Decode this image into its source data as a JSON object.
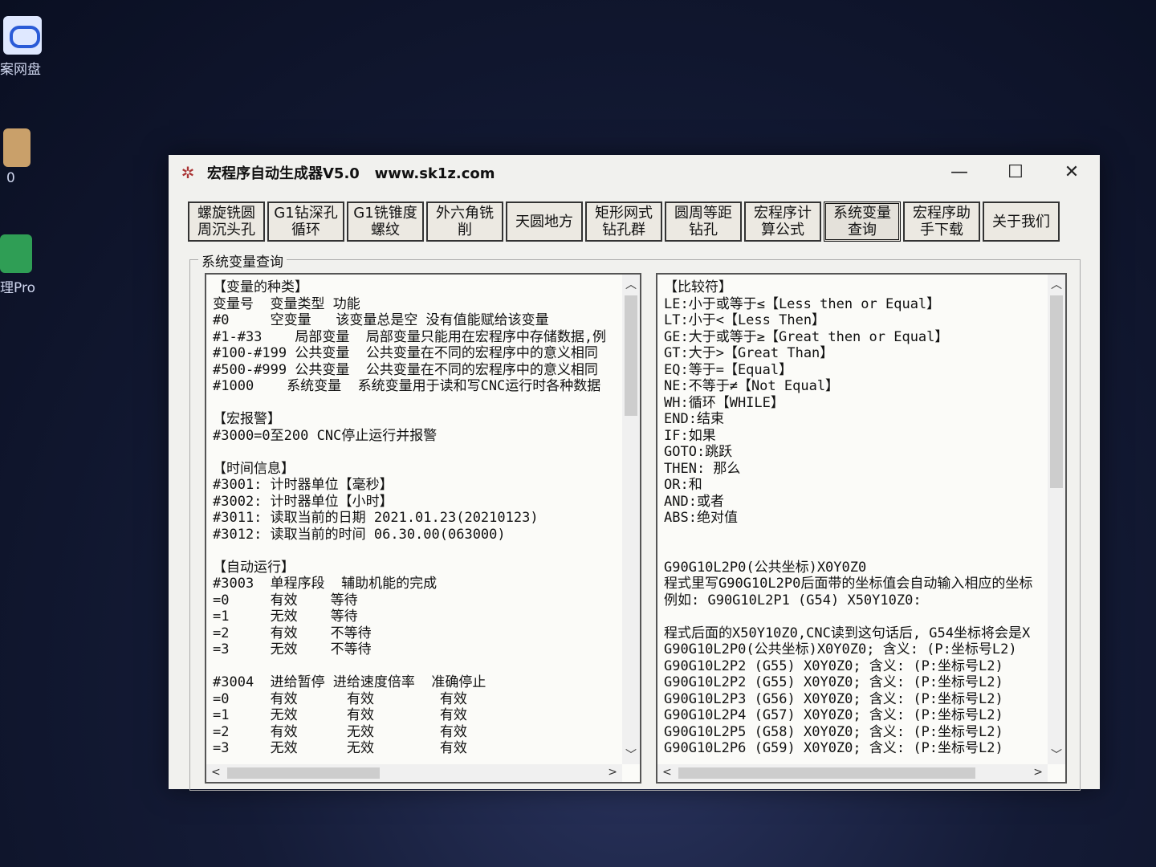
{
  "desktop": {
    "icons": [
      {
        "label": "案网盘"
      },
      {
        "label": "0"
      },
      {
        "label": "理Pro"
      }
    ]
  },
  "window": {
    "title": "宏程序自动生成器V5.0   www.sk1z.com",
    "controls": {
      "minimize": "—",
      "maximize": "☐",
      "close": "✕"
    }
  },
  "tabs": [
    {
      "label": "螺旋铣圆\n周沉头孔"
    },
    {
      "label": "G1钻深孔\n循环"
    },
    {
      "label": "G1铣锥度\n螺纹"
    },
    {
      "label": "外六角铣\n削"
    },
    {
      "label": "天圆地方"
    },
    {
      "label": "矩形网式\n钻孔群"
    },
    {
      "label": "圆周等距\n钻孔"
    },
    {
      "label": "宏程序计\n算公式"
    },
    {
      "label": "系统变量\n查询",
      "active": true
    },
    {
      "label": "宏程序助\n手下载"
    },
    {
      "label": "关于我们"
    }
  ],
  "group": {
    "title": "系统变量查询"
  },
  "left_pane": {
    "text": "【变量的种类】\n变量号  变量类型 功能\n#0     空变量   该变量总是空 没有值能赋给该变量\n#1-#33    局部变量  局部变量只能用在宏程序中存储数据,例\n#100-#199 公共变量  公共变量在不同的宏程序中的意义相同\n#500-#999 公共变量  公共变量在不同的宏程序中的意义相同\n#1000    系统变量  系统变量用于读和写CNC运行时各种数据\n\n【宏报警】\n#3000=0至200 CNC停止运行并报警\n\n【时间信息】\n#3001: 计时器单位【毫秒】\n#3002: 计时器单位【小时】\n#3011: 读取当前的日期 2021.01.23(20210123)\n#3012: 读取当前的时间 06.30.00(063000)\n\n【自动运行】\n#3003  单程序段  辅助机能的完成\n=0     有效    等待\n=1     无效    等待\n=2     有效    不等待\n=3     无效    不等待\n\n#3004  进给暂停 进给速度倍率  准确停止\n=0     有效      有效        有效\n=1     无效      有效        有效\n=2     有效      无效        有效\n=3     无效      无效        有效"
  },
  "right_pane": {
    "text": "【比较符】\nLE:小于或等于≤【Less then or Equal】\nLT:小于<【Less Then】\nGE:大于或等于≥【Great then or Equal】\nGT:大于>【Great Than】\nEQ:等于=【Equal】\nNE:不等于≠【Not Equal】\nWH:循环【WHILE】\nEND:结束\nIF:如果\nGOTO:跳跃\nTHEN: 那么\nOR:和\nAND:或者\nABS:绝对值\n\n\nG90G10L2P0(公共坐标)X0Y0Z0\n程式里写G90G10L2P0后面带的坐标值会自动输入相应的坐标\n例如: G90G10L2P1 (G54) X50Y10Z0:\n\n程式后面的X50Y10Z0,CNC读到这句话后, G54坐标将会是X\nG90G10L2P0(公共坐标)X0Y0Z0; 含义: (P:坐标号L2)\nG90G10L2P2 (G55) X0Y0Z0; 含义: (P:坐标号L2)\nG90G10L2P2 (G55) X0Y0Z0; 含义: (P:坐标号L2)\nG90G10L2P3 (G56) X0Y0Z0; 含义: (P:坐标号L2)\nG90G10L2P4 (G57) X0Y0Z0; 含义: (P:坐标号L2)\nG90G10L2P5 (G58) X0Y0Z0; 含义: (P:坐标号L2)\nG90G10L2P6 (G59) X0Y0Z0; 含义: (P:坐标号L2)"
  },
  "scroll_glyphs": {
    "up": "︿",
    "down": "﹀",
    "left": "<",
    "right": ">"
  }
}
